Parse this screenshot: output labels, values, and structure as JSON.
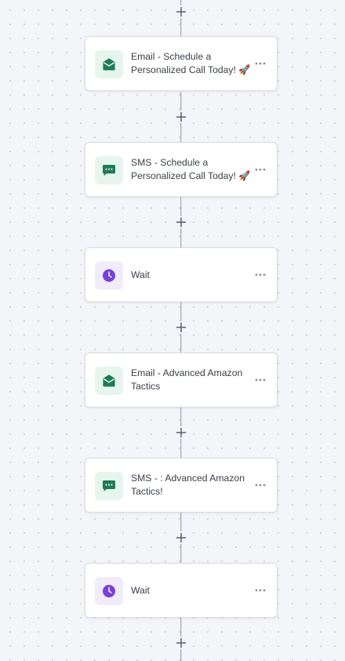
{
  "workflow": {
    "steps": [
      {
        "type": "email",
        "icon": "email-open-icon",
        "label": "Email - Schedule a Personalized Call Today! 🚀"
      },
      {
        "type": "sms",
        "icon": "sms-chat-icon",
        "label": "SMS - Schedule a Personalized Call Today! 🚀"
      },
      {
        "type": "wait",
        "icon": "clock-icon",
        "label": "Wait"
      },
      {
        "type": "email",
        "icon": "email-open-icon",
        "label": "Email - Advanced Amazon Tactics"
      },
      {
        "type": "sms",
        "icon": "sms-chat-icon",
        "label": "SMS - : Advanced Amazon Tactics!"
      },
      {
        "type": "wait",
        "icon": "clock-icon",
        "label": "Wait"
      }
    ]
  },
  "colors": {
    "canvas_background": "#f4f5f8",
    "email_icon": "#1f7a57",
    "sms_icon": "#1f7a57",
    "wait_icon": "#7a3fd6",
    "connector": "#8f949c"
  }
}
